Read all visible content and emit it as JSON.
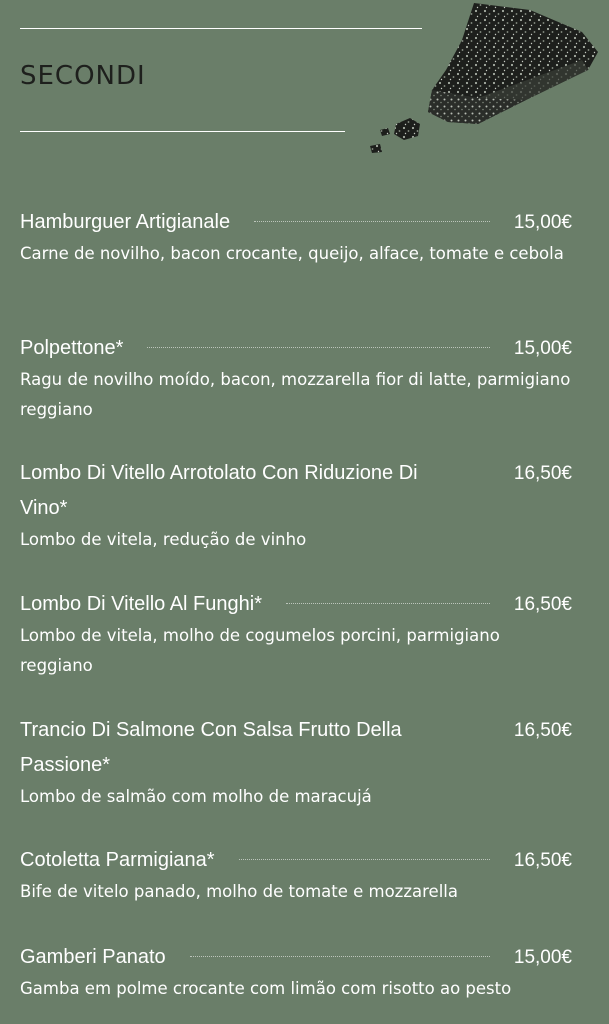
{
  "section": {
    "title": "SECONDI"
  },
  "items": [
    {
      "name": "Hamburguer Artigianale",
      "price": "15,00€",
      "description": "Carne de novilho, bacon crocante, queijo, alface, tomate e cebola"
    },
    {
      "name": "Polpettone*",
      "price": "15,00€",
      "description": "Ragu de novilho moído, bacon, mozzarella fior di latte, parmigiano reggiano"
    },
    {
      "name": "Lombo Di Vitello Arrotolato Con Riduzione Di Vino*",
      "price": "16,50€",
      "description": "Lombo de vitela, redução de vinho"
    },
    {
      "name": "Lombo Di Vitello Al Funghi*",
      "price": "16,50€",
      "description": "Lombo de vitela, molho de cogumelos porcini, parmigiano reggiano"
    },
    {
      "name": "Trancio Di Salmone Con Salsa Frutto Della Passione*",
      "price": "16,50€",
      "description": "Lombo de salmão com molho de maracujá"
    },
    {
      "name": "Cotoletta Parmigiana*",
      "price": "16,50€",
      "description": "Bife de vitelo panado, molho de tomate e mozzarella"
    },
    {
      "name": "Gamberi Panato",
      "price": "15,00€",
      "description": "Gamba em polme crocante com limão com risotto ao pesto"
    }
  ]
}
